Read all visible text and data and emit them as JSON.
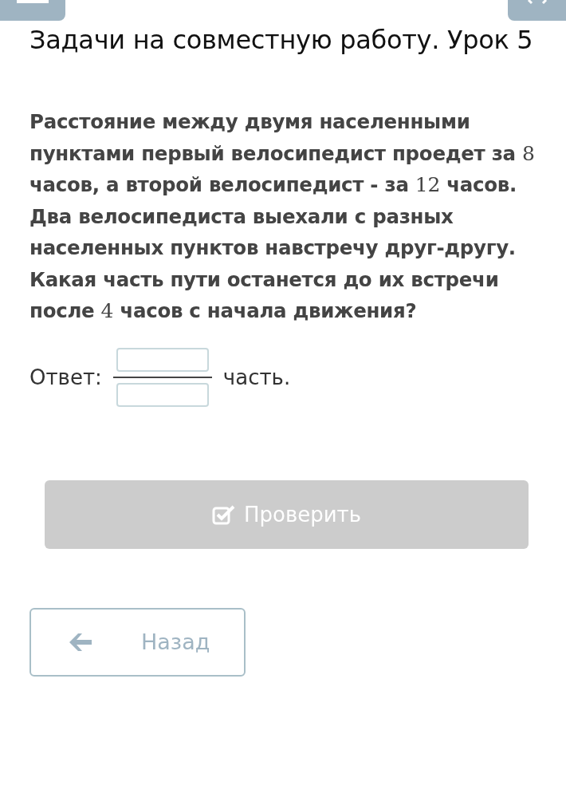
{
  "top_buttons": [
    {
      "kind": "menu"
    },
    {
      "kind": "close"
    }
  ],
  "title": "Задачи на совместную работу. Урок 5",
  "question": [
    {
      "kind": "text",
      "text": "Расстояние между двумя населенными пунктами первый велосипедист проедет за "
    },
    {
      "kind": "math",
      "text": "8"
    },
    {
      "kind": "text",
      "text": " часов, а второй велосипедист - за "
    },
    {
      "kind": "math",
      "text": "12"
    },
    {
      "kind": "text",
      "text": " часов. Два велосипедиста выехали с разных населенных пунктов навстречу друг-другу. Какая часть пути останется до их встречи после "
    },
    {
      "kind": "math",
      "text": "4"
    },
    {
      "kind": "text",
      "text": " часов с начала движения?"
    }
  ],
  "answer": {
    "label": "Ответ:",
    "suffix": "часть."
  },
  "check_button": {
    "label": "Проверить",
    "disabled": true
  },
  "back_button": {
    "label": "Назад"
  }
}
